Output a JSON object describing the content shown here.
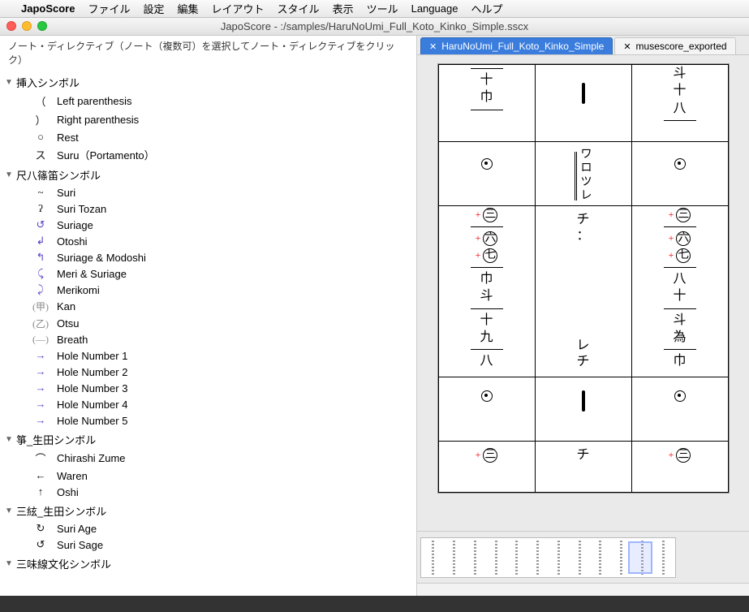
{
  "menubar": {
    "apple": "",
    "appname": "JapoScore",
    "items": [
      "ファイル",
      "設定",
      "編集",
      "レイアウト",
      "スタイル",
      "表示",
      "ツール",
      "Language",
      "ヘルプ"
    ]
  },
  "window": {
    "title": "JapoScore - :/samples/HaruNoUmi_Full_Koto_Kinko_Simple.sscx"
  },
  "leftpanel": {
    "header": "ノート・ディレクティブ（ノート（複数可）を選択してノート・ディレクティブをクリック）",
    "groups": [
      {
        "label": "挿入シンボル",
        "items": [
          {
            "sym": "（",
            "label": "Left parenthesis"
          },
          {
            "sym": "）",
            "label": "Right parenthesis"
          },
          {
            "sym": "○",
            "label": "Rest"
          },
          {
            "sym": "ス",
            "label": "Suru（Portamento）"
          }
        ]
      },
      {
        "label": "尺八篠笛シンボル",
        "items": [
          {
            "sym": "~",
            "label": "Suri"
          },
          {
            "sym": "ʔ",
            "label": "Suri Tozan"
          },
          {
            "sym": "↺",
            "label": "Suriage",
            "blue": true
          },
          {
            "sym": "↲",
            "label": "Otoshi",
            "blue": true
          },
          {
            "sym": "↰",
            "label": "Suriage & Modoshi",
            "blue": true
          },
          {
            "sym": "⤹",
            "label": "Meri & Suriage",
            "blue": true
          },
          {
            "sym": "⤸",
            "label": "Merikomi",
            "blue": true
          },
          {
            "sym": "(甲)",
            "label": "Kan",
            "grey": true
          },
          {
            "sym": "(乙)",
            "label": "Otsu",
            "grey": true
          },
          {
            "sym": "(—)",
            "label": "Breath",
            "grey": true
          },
          {
            "sym": "→",
            "label": "Hole Number 1",
            "blue": true
          },
          {
            "sym": "→",
            "label": "Hole Number 2",
            "blue": true
          },
          {
            "sym": "→",
            "label": "Hole Number 3",
            "blue": true
          },
          {
            "sym": "→",
            "label": "Hole Number 4",
            "blue": true
          },
          {
            "sym": "→",
            "label": "Hole Number 5",
            "blue": true
          }
        ]
      },
      {
        "label": "箏_生田シンボル",
        "items": [
          {
            "sym": "⌒",
            "label": "Chirashi Zume"
          },
          {
            "sym": "←",
            "label": "Waren"
          },
          {
            "sym": "↑",
            "label": "Oshi"
          }
        ]
      },
      {
        "label": "三絃_生田シンボル",
        "items": [
          {
            "sym": "↻",
            "label": "Suri Age"
          },
          {
            "sym": "↺",
            "label": "Suri Sage"
          }
        ]
      },
      {
        "label": "三味線文化シンボル",
        "items": []
      }
    ]
  },
  "tabs": {
    "active": "HaruNoUmi_Full_Koto_Kinko_Simple",
    "inactive": "musescore_exported",
    "close": "✕"
  },
  "score": {
    "row1": {
      "c1": [
        "十",
        "巾"
      ],
      "c2_dash": true,
      "c3": [
        "斗",
        "十",
        "八"
      ]
    },
    "row2": {
      "dot": true,
      "c2": [
        "ワ",
        "ロ",
        "ツ",
        "レ"
      ]
    },
    "row3": {
      "plus_circles": [
        "三",
        "六",
        "七"
      ],
      "c1_extra": [
        "巾",
        "斗",
        "十",
        "九",
        "八"
      ],
      "c2_top": [
        "チ",
        "："
      ],
      "c2_bottom": [
        "レ",
        "チ"
      ],
      "c3_plus_circles": [
        "三",
        "六",
        "七"
      ],
      "c3_extra": [
        "八",
        "十",
        "斗",
        "為",
        "巾"
      ]
    },
    "row4": {
      "dot": true,
      "c2_dash": true
    },
    "row5": {
      "plus_circle": "三",
      "c2": "チ"
    }
  },
  "status": {
    "text": ""
  }
}
